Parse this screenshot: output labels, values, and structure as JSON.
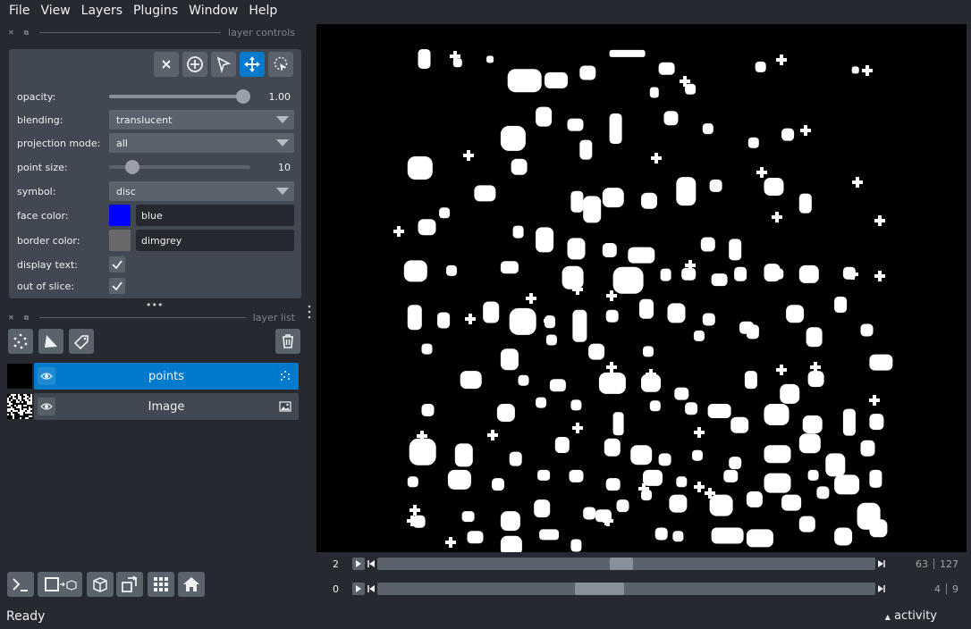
{
  "menu": [
    "File",
    "View",
    "Layers",
    "Plugins",
    "Window",
    "Help"
  ],
  "layer_controls": {
    "title": "layer controls",
    "opacity": {
      "label": "opacity:",
      "value": "1.00",
      "level": 1.0
    },
    "blending": {
      "label": "blending:",
      "value": "translucent"
    },
    "projection_mode": {
      "label": "projection mode:",
      "value": "all"
    },
    "point_size": {
      "label": "point size:",
      "value": "10",
      "level": 0.13
    },
    "symbol": {
      "label": "symbol:",
      "value": "disc"
    },
    "face_color": {
      "label": "face color:",
      "value": "blue",
      "swatch": "#0000ff"
    },
    "border_color": {
      "label": "border color:",
      "value": "dimgrey",
      "swatch": "#696969"
    },
    "display_text": {
      "label": "display text:",
      "checked": true
    },
    "out_of_slice": {
      "label": "out of slice:",
      "checked": true
    },
    "mode_buttons": [
      "close-icon",
      "add-point-icon",
      "select-icon",
      "pan-zoom-icon",
      "lasso-select-icon"
    ],
    "active_mode": "pan-zoom-icon"
  },
  "layer_list": {
    "title": "layer list",
    "layers": [
      {
        "name": "points",
        "type": "points",
        "selected": true
      },
      {
        "name": "Image",
        "type": "image",
        "selected": false
      }
    ]
  },
  "dims": [
    {
      "axis": "2",
      "current": "63",
      "total": "127",
      "position": 0.49
    },
    {
      "axis": "0",
      "current": "4",
      "total": "9",
      "position": 0.44
    }
  ],
  "status": {
    "text": "Ready",
    "activity": "activity"
  },
  "colors": {
    "accent": "#007acc",
    "background": "#262930",
    "panel": "#414851"
  }
}
